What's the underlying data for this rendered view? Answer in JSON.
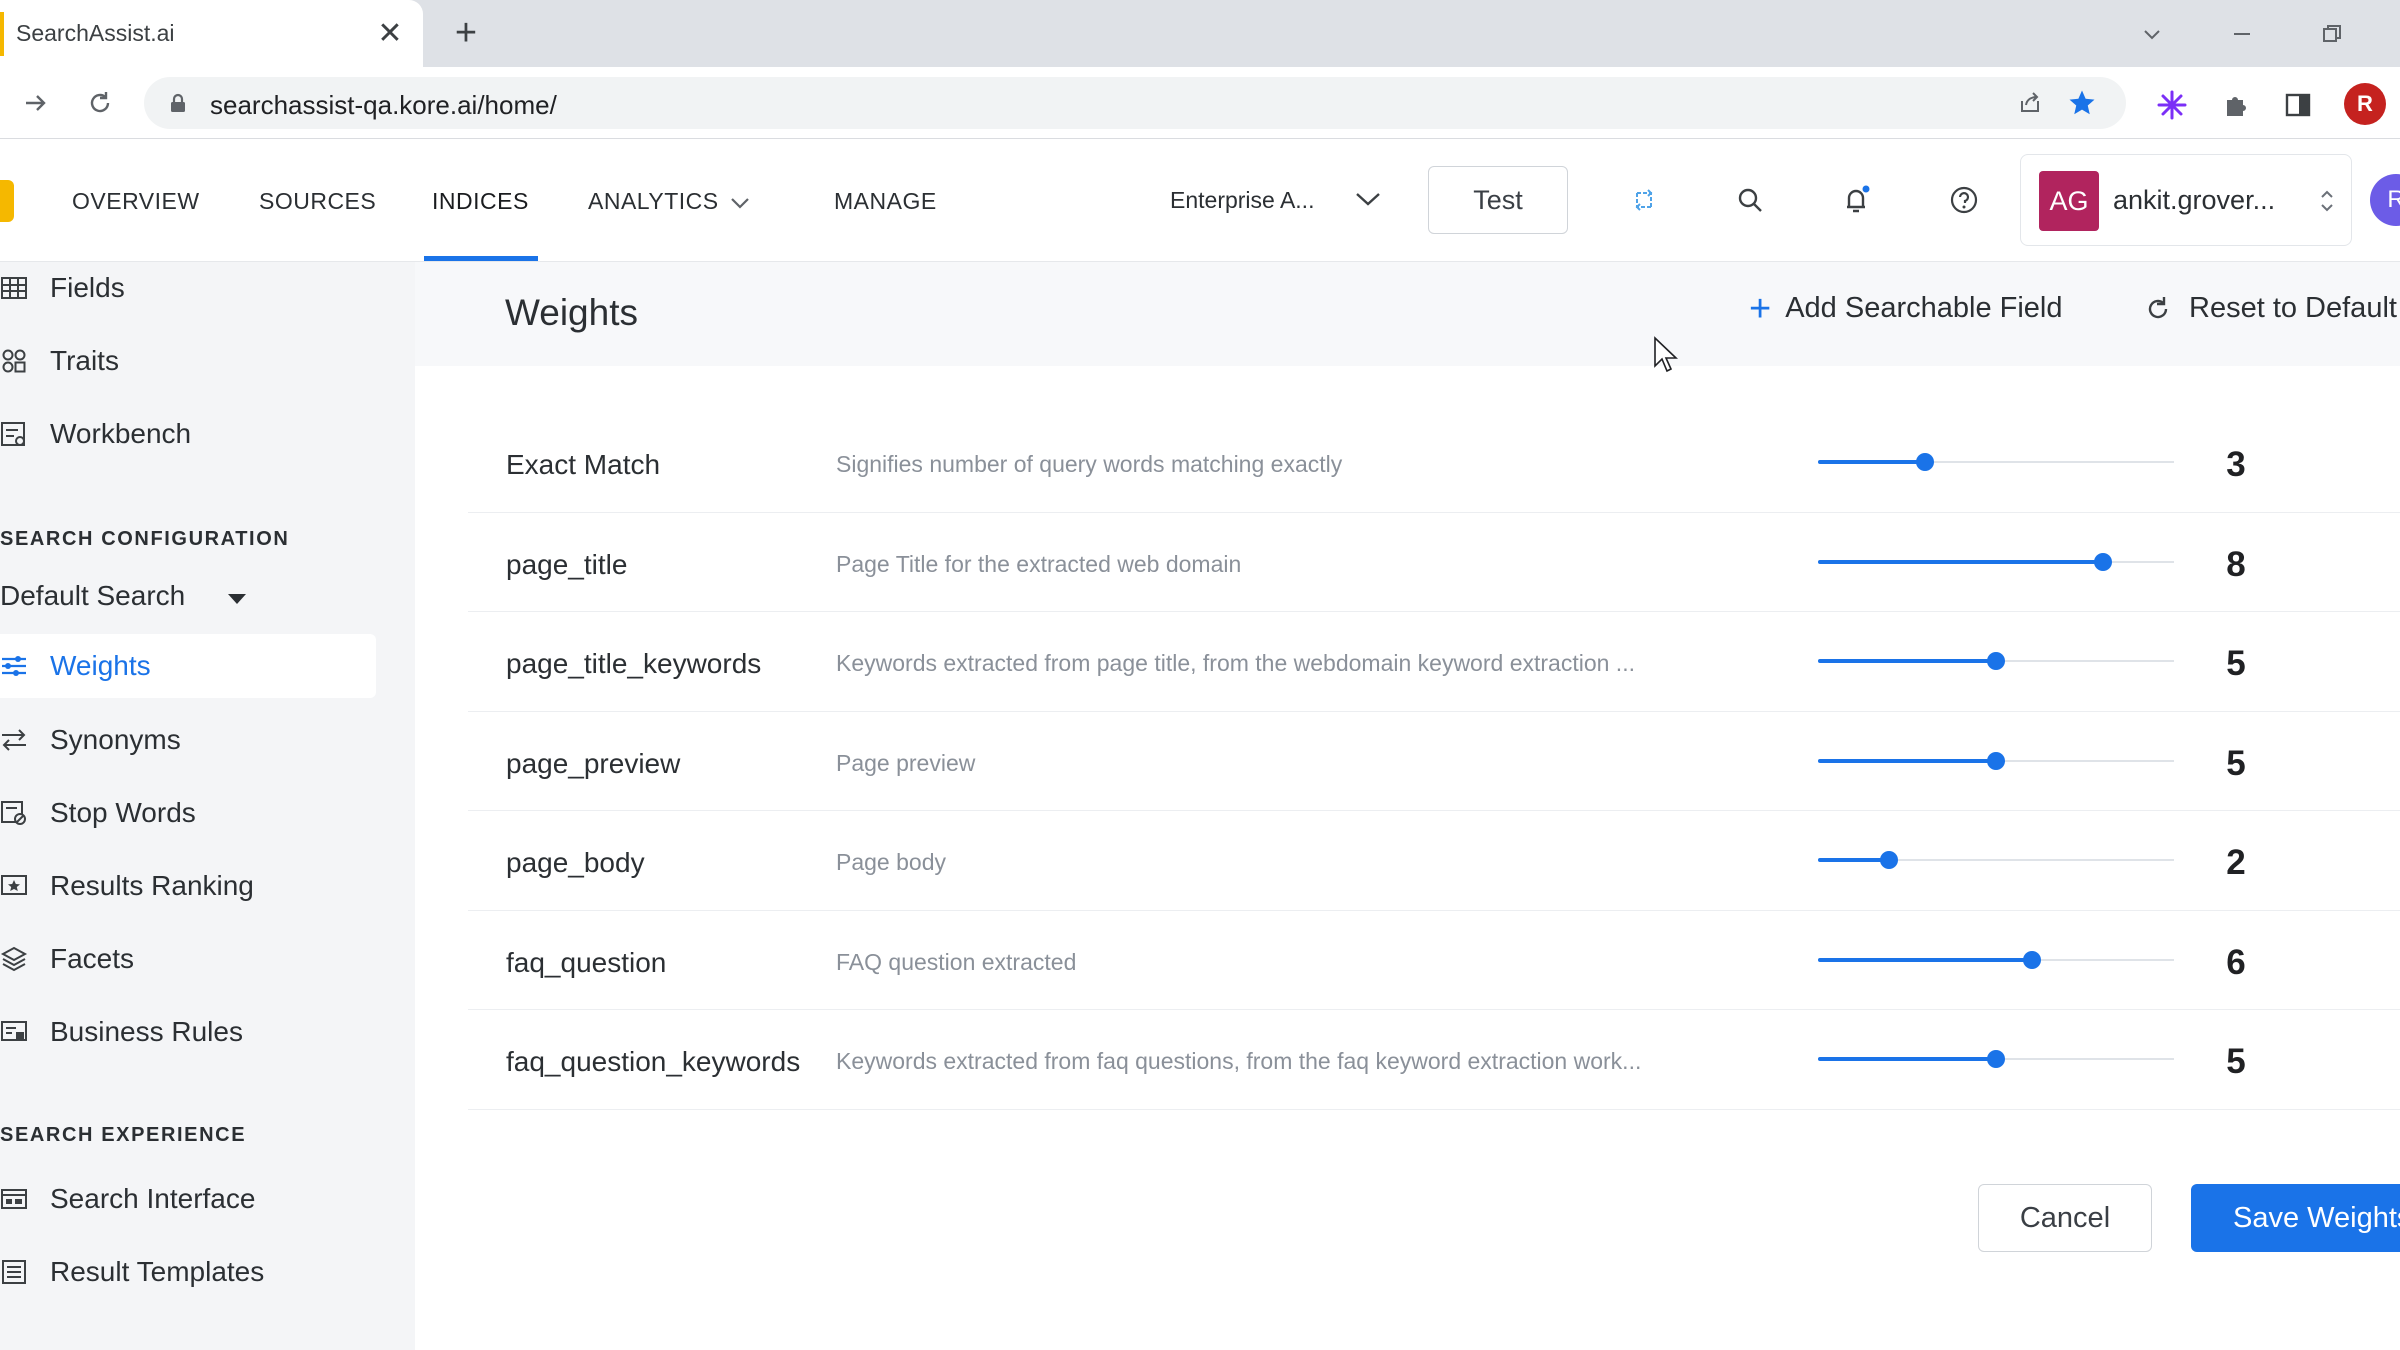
{
  "browser": {
    "tab_title": "SearchAssist.ai",
    "tab_close": "✕",
    "new_tab": "+",
    "url": "searchassist-qa.kore.ai/home/",
    "profile_initial": "R"
  },
  "appbar": {
    "nav": [
      {
        "label": "OVERVIEW"
      },
      {
        "label": "SOURCES"
      },
      {
        "label": "INDICES",
        "active": true
      },
      {
        "label": "ANALYTICS"
      },
      {
        "label": "MANAGE"
      }
    ],
    "workspace": "Enterprise A...",
    "test_label": "Test",
    "user_initials": "AG",
    "user_name": "ankit.grover...",
    "corner_initial": "R"
  },
  "sidebar": {
    "top_items": [
      {
        "label": "Fields",
        "icon": "grid-icon"
      },
      {
        "label": "Traits",
        "icon": "traits-icon"
      },
      {
        "label": "Workbench",
        "icon": "workbench-icon"
      }
    ],
    "section_config": "SEARCH CONFIGURATION",
    "selector": "Default Search",
    "config_items": [
      {
        "label": "Weights",
        "icon": "weights-icon",
        "active": true
      },
      {
        "label": "Synonyms",
        "icon": "synonyms-icon"
      },
      {
        "label": "Stop Words",
        "icon": "stop-words-icon"
      },
      {
        "label": "Results Ranking",
        "icon": "ranking-icon"
      },
      {
        "label": "Facets",
        "icon": "facets-icon"
      },
      {
        "label": "Business Rules",
        "icon": "rules-icon"
      }
    ],
    "section_experience": "SEARCH EXPERIENCE",
    "experience_items": [
      {
        "label": "Search Interface",
        "icon": "interface-icon"
      },
      {
        "label": "Result Templates",
        "icon": "templates-icon"
      }
    ]
  },
  "main": {
    "title": "Weights",
    "add_field_label": "Add Searchable Field",
    "reset_label": "Reset to Default",
    "slider_max": 10,
    "weights": [
      {
        "name": "Exact Match",
        "description": "Signifies number of query words matching exactly",
        "value": 3
      },
      {
        "name": "page_title",
        "description": "Page Title for the extracted web domain",
        "value": 8
      },
      {
        "name": "page_title_keywords",
        "description": "Keywords extracted from page title, from the webdomain keyword extraction ...",
        "value": 5
      },
      {
        "name": "page_preview",
        "description": "Page preview",
        "value": 5
      },
      {
        "name": "page_body",
        "description": "Page body",
        "value": 2
      },
      {
        "name": "faq_question",
        "description": "FAQ question extracted",
        "value": 6
      },
      {
        "name": "faq_question_keywords",
        "description": "Keywords extracted from faq questions, from the faq keyword extraction work...",
        "value": 5
      }
    ],
    "cancel_label": "Cancel",
    "save_label": "Save Weights"
  },
  "colors": {
    "accent": "#1a73e8",
    "brand_yellow": "#f5b800",
    "avatar": "#b1245e"
  }
}
